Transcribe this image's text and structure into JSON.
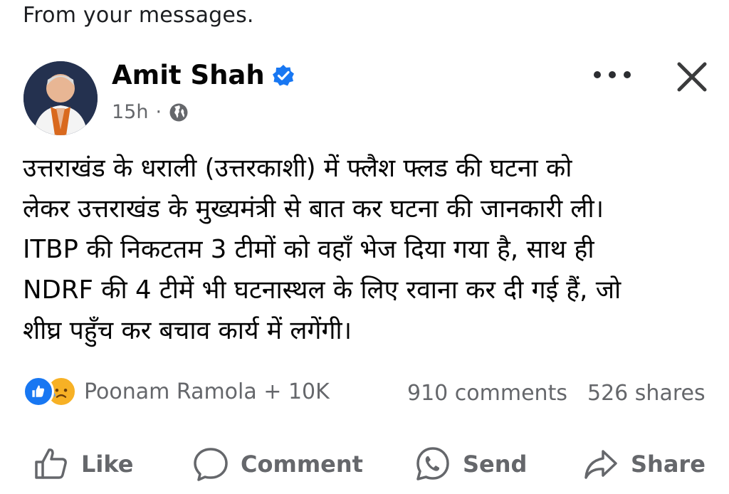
{
  "context": {
    "header": "From your messages."
  },
  "post": {
    "author": "Amit Shah",
    "time": "15h",
    "separator": "·",
    "text_lines": [
      "उत्तराखंड के धराली (उत्तरकाशी) में फ्लैश फ्लड की घटना को",
      "लेकर उत्तराखंड के मुख्यमंत्री से बात कर घटना की जानकारी ली।",
      "ITBP की निकटतम 3 टीमों को वहाँ भेज दिया गया है, साथ ही",
      "NDRF की 4 टीमें भी घटनास्थल के लिए रवाना कर दी गई हैं, जो",
      "शीघ्र पहुँच कर बचाव कार्य में लगेंगी।"
    ]
  },
  "stats": {
    "reactors": "Poonam Ramola + 10K",
    "comments": "910 comments",
    "shares": "526 shares"
  },
  "actions": {
    "like": "Like",
    "comment": "Comment",
    "send": "Send",
    "share": "Share"
  },
  "icons": {
    "verified": "verified-badge-icon",
    "audience": "globe-icon",
    "more": "more-options-icon",
    "close": "close-icon"
  },
  "colors": {
    "brand_blue": "#1877f2",
    "muted_text": "#65676b",
    "sad_yellow": "#f7b125"
  }
}
